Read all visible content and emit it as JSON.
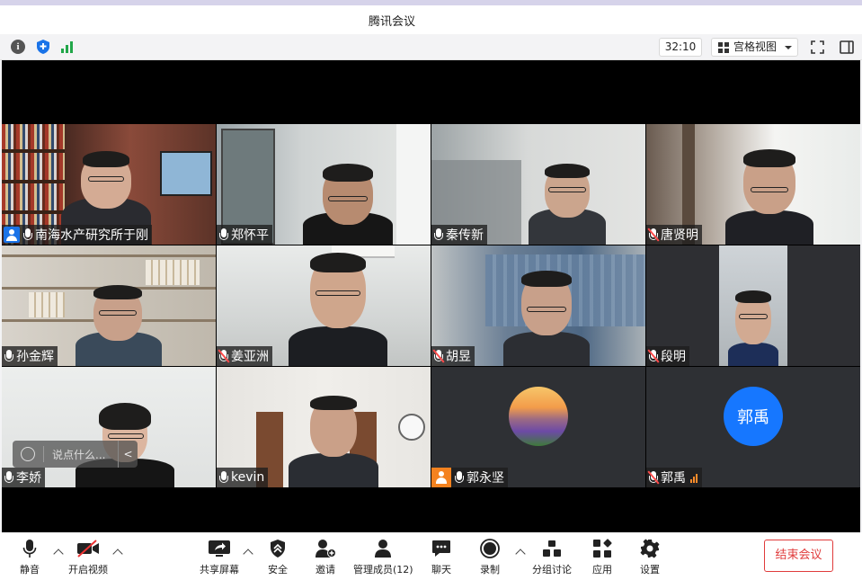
{
  "window": {
    "title": "腾讯会议"
  },
  "toolbar": {
    "timer": "32:10",
    "view_mode": "宫格视图",
    "icons": [
      "info-icon",
      "shield-icon",
      "signal-icon",
      "fullscreen-icon",
      "sidebar-icon"
    ]
  },
  "participants": [
    {
      "name": "南海水产研究所于刚",
      "mic": "on",
      "badge": "host",
      "active": true
    },
    {
      "name": "郑怀平",
      "mic": "on"
    },
    {
      "name": "秦传新",
      "mic": "on"
    },
    {
      "name": "唐贤明",
      "mic": "muted"
    },
    {
      "name": "孙金辉",
      "mic": "on"
    },
    {
      "name": "姜亚洲",
      "mic": "muted"
    },
    {
      "name": "胡昱",
      "mic": "muted"
    },
    {
      "name": "段明",
      "mic": "muted"
    },
    {
      "name": "李娇",
      "mic": "on"
    },
    {
      "name": "kevin",
      "mic": "on"
    },
    {
      "name": "郭永坚",
      "mic": "on",
      "badge": "guest",
      "avatar": "image"
    },
    {
      "name": "郭禹",
      "mic": "muted",
      "avatar": "text",
      "avatar_text": "郭禹",
      "avatar_color": "#1677ff",
      "network": "weak"
    }
  ],
  "chat": {
    "placeholder": "说点什么..."
  },
  "bottombar": {
    "mute": "静音",
    "video": "开启视频",
    "share": "共享屏幕",
    "security": "安全",
    "invite": "邀请",
    "manage": "管理成员(12)",
    "chat": "聊天",
    "record": "录制",
    "breakout": "分组讨论",
    "apps": "应用",
    "settings": "设置",
    "end": "结束会议"
  },
  "colors": {
    "end_button": "#e03b3b",
    "active_speaker": "#3dbf58",
    "accent": "#1677ff"
  }
}
